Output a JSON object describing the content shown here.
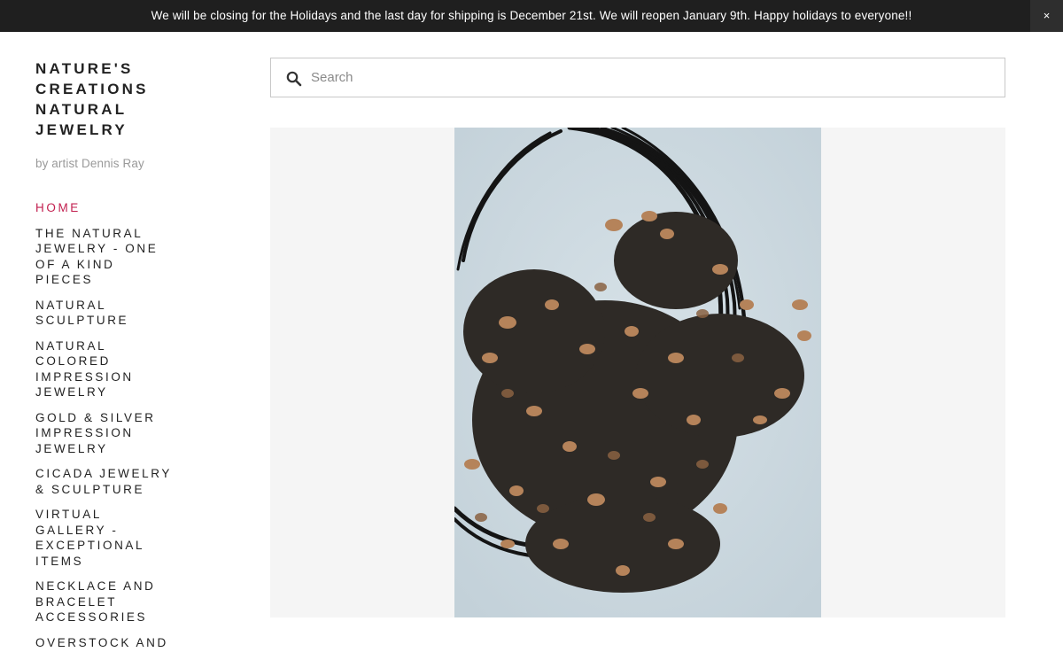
{
  "announcement": {
    "text": "We will be closing for the Holidays and the last day for shipping is December 21st. We will reopen January 9th.  Happy holidays to everyone!!",
    "close_label": "×"
  },
  "site": {
    "title_lines": [
      "NATURE'S",
      "CREATIONS",
      "NATURAL",
      "JEWELRY"
    ],
    "tagline": "by artist Dennis Ray"
  },
  "nav": {
    "items": [
      {
        "lines": [
          "HOME"
        ],
        "active": true
      },
      {
        "lines": [
          "THE NATURAL",
          "JEWELRY - ONE",
          "OF A KIND",
          "PIECES"
        ]
      },
      {
        "lines": [
          "NATURAL",
          "SCULPTURE"
        ]
      },
      {
        "lines": [
          "NATURAL",
          "COLORED",
          "IMPRESSION",
          "JEWELRY"
        ]
      },
      {
        "lines": [
          "GOLD & SILVER",
          "IMPRESSION",
          "JEWELRY"
        ]
      },
      {
        "lines": [
          "CICADA JEWELRY",
          "& SCULPTURE"
        ]
      },
      {
        "lines": [
          "VIRTUAL",
          "GALLERY -",
          "EXCEPTIONAL",
          "ITEMS"
        ]
      },
      {
        "lines": [
          "NECKLACE AND",
          "BRACELET",
          "ACCESSORIES"
        ]
      },
      {
        "lines": [
          "OVERSTOCK AND"
        ]
      }
    ]
  },
  "search": {
    "placeholder": "Search",
    "value": "",
    "icon": "search-icon"
  },
  "colors": {
    "announcement_bg": "#1f1f1f",
    "accent_active": "#c21f4f",
    "tagline": "#9a9a9a",
    "hero_bg": "#f5f5f5",
    "photo_bg": "#cdd9e0"
  }
}
